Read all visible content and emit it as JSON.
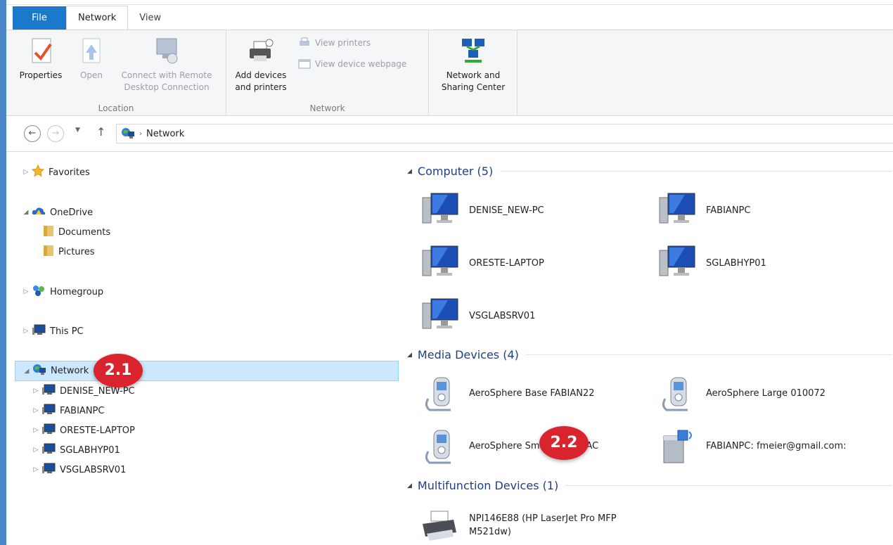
{
  "ribbon": {
    "tabs": [
      "File",
      "Network",
      "View"
    ],
    "location_group": {
      "label": "Location",
      "properties": "Properties",
      "open": "Open",
      "connect_rdp_line1": "Connect with Remote",
      "connect_rdp_line2": "Desktop Connection"
    },
    "network_group": {
      "label": "Network",
      "add_devices_line1": "Add devices",
      "add_devices_line2": "and printers",
      "view_printers": "View printers",
      "view_device_webpage": "View device webpage"
    },
    "sharing": {
      "line1": "Network and",
      "line2": "Sharing Center"
    }
  },
  "address": {
    "path": "Network"
  },
  "navpane": {
    "favorites": "Favorites",
    "onedrive": "OneDrive",
    "documents": "Documents",
    "pictures": "Pictures",
    "homegroup": "Homegroup",
    "thispc": "This PC",
    "network": "Network",
    "network_children": [
      "DENISE_NEW-PC",
      "FABIANPC",
      "ORESTE-LAPTOP",
      "SGLABHYP01",
      "VSGLABSRV01"
    ]
  },
  "content": {
    "computer_header": "Computer (5)",
    "computers": [
      "DENISE_NEW-PC",
      "FABIANPC",
      "ORESTE-LAPTOP",
      "SGLABHYP01",
      "VSGLABSRV01"
    ],
    "media_header": "Media Devices (4)",
    "media": [
      "AeroSphere Base FABIAN22",
      "AeroSphere Large 010072",
      "AeroSphere Sma",
      "AC",
      "FABIANPC: fmeier@gmail.com:"
    ],
    "mfd_header": "Multifunction Devices (1)",
    "mfd_line1": "NPI146E88 (HP LaserJet Pro MFP",
    "mfd_line2": "M521dw)"
  },
  "badges": {
    "nav": "2.1",
    "content": "2.2"
  },
  "colors": {
    "file_tab": "#1979ca",
    "selection": "#cce8ff",
    "group_header": "#1e3f8a",
    "badge": "#d9232d"
  }
}
